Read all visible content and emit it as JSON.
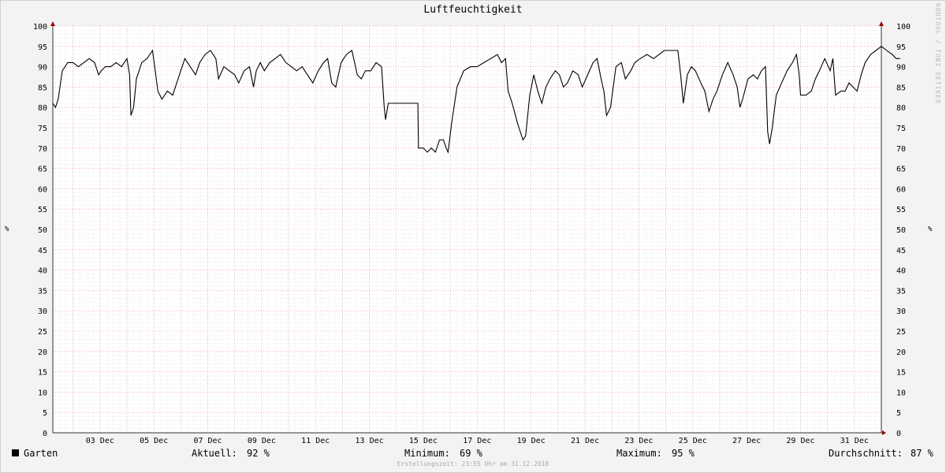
{
  "chart_data": {
    "type": "line",
    "title": "Luftfeuchtigkeit",
    "ylabel": "%",
    "ylim": [
      0,
      100
    ],
    "y_ticks": [
      0,
      5,
      10,
      15,
      20,
      25,
      30,
      35,
      40,
      45,
      50,
      55,
      60,
      65,
      70,
      75,
      80,
      85,
      90,
      95,
      100
    ],
    "x_tick_labels": [
      "03 Dec",
      "05 Dec",
      "07 Dec",
      "09 Dec",
      "11 Dec",
      "13 Dec",
      "15 Dec",
      "17 Dec",
      "19 Dec",
      "21 Dec",
      "23 Dec",
      "25 Dec",
      "27 Dec",
      "29 Dec",
      "31 Dec"
    ],
    "x_tick_days": [
      3,
      5,
      7,
      9,
      11,
      13,
      15,
      17,
      19,
      21,
      23,
      25,
      27,
      29,
      31
    ],
    "xlim_days": [
      1.25,
      32.0
    ],
    "grid": true,
    "series": [
      {
        "name": "Garten",
        "color": "#000000",
        "points": [
          [
            1.25,
            81
          ],
          [
            1.35,
            80
          ],
          [
            1.45,
            82
          ],
          [
            1.6,
            89
          ],
          [
            1.8,
            91
          ],
          [
            2.0,
            91
          ],
          [
            2.2,
            90
          ],
          [
            2.4,
            91
          ],
          [
            2.6,
            92
          ],
          [
            2.8,
            91
          ],
          [
            2.95,
            88
          ],
          [
            3.05,
            89
          ],
          [
            3.2,
            90
          ],
          [
            3.4,
            90
          ],
          [
            3.6,
            91
          ],
          [
            3.8,
            90
          ],
          [
            4.0,
            92
          ],
          [
            4.1,
            88
          ],
          [
            4.15,
            78
          ],
          [
            4.25,
            80
          ],
          [
            4.35,
            87
          ],
          [
            4.55,
            91
          ],
          [
            4.75,
            92
          ],
          [
            4.95,
            94
          ],
          [
            5.05,
            89
          ],
          [
            5.15,
            84
          ],
          [
            5.3,
            82
          ],
          [
            5.5,
            84
          ],
          [
            5.7,
            83
          ],
          [
            5.85,
            86
          ],
          [
            6.0,
            89
          ],
          [
            6.15,
            92
          ],
          [
            6.35,
            90
          ],
          [
            6.55,
            88
          ],
          [
            6.7,
            91
          ],
          [
            6.9,
            93
          ],
          [
            7.1,
            94
          ],
          [
            7.3,
            92
          ],
          [
            7.4,
            87
          ],
          [
            7.6,
            90
          ],
          [
            7.8,
            89
          ],
          [
            8.0,
            88
          ],
          [
            8.15,
            86
          ],
          [
            8.35,
            89
          ],
          [
            8.55,
            90
          ],
          [
            8.7,
            85
          ],
          [
            8.8,
            89
          ],
          [
            8.95,
            91
          ],
          [
            9.1,
            89
          ],
          [
            9.3,
            91
          ],
          [
            9.5,
            92
          ],
          [
            9.7,
            93
          ],
          [
            9.9,
            91
          ],
          [
            10.1,
            90
          ],
          [
            10.3,
            89
          ],
          [
            10.5,
            90
          ],
          [
            10.7,
            88
          ],
          [
            10.9,
            86
          ],
          [
            11.1,
            89
          ],
          [
            11.3,
            91
          ],
          [
            11.45,
            92
          ],
          [
            11.6,
            86
          ],
          [
            11.75,
            85
          ],
          [
            11.95,
            91
          ],
          [
            12.15,
            93
          ],
          [
            12.35,
            94
          ],
          [
            12.55,
            88
          ],
          [
            12.7,
            87
          ],
          [
            12.85,
            89
          ],
          [
            13.05,
            89
          ],
          [
            13.25,
            91
          ],
          [
            13.45,
            90
          ],
          [
            13.55,
            80
          ],
          [
            13.6,
            77
          ],
          [
            13.7,
            81
          ],
          [
            14.8,
            81
          ],
          [
            14.82,
            70
          ],
          [
            15.0,
            70
          ],
          [
            15.15,
            69
          ],
          [
            15.3,
            70
          ],
          [
            15.45,
            69
          ],
          [
            15.6,
            72
          ],
          [
            15.75,
            72
          ],
          [
            15.85,
            70
          ],
          [
            15.92,
            69
          ],
          [
            16.05,
            76
          ],
          [
            16.25,
            85
          ],
          [
            16.5,
            89
          ],
          [
            16.75,
            90
          ],
          [
            17.0,
            90
          ],
          [
            17.25,
            91
          ],
          [
            17.5,
            92
          ],
          [
            17.75,
            93
          ],
          [
            17.9,
            91
          ],
          [
            18.05,
            92
          ],
          [
            18.15,
            84
          ],
          [
            18.3,
            81
          ],
          [
            18.5,
            76
          ],
          [
            18.7,
            72
          ],
          [
            18.8,
            73
          ],
          [
            18.95,
            83
          ],
          [
            19.1,
            88
          ],
          [
            19.25,
            84
          ],
          [
            19.4,
            81
          ],
          [
            19.55,
            85
          ],
          [
            19.7,
            87
          ],
          [
            19.9,
            89
          ],
          [
            20.05,
            88
          ],
          [
            20.2,
            85
          ],
          [
            20.35,
            86
          ],
          [
            20.55,
            89
          ],
          [
            20.75,
            88
          ],
          [
            20.9,
            85
          ],
          [
            21.1,
            88
          ],
          [
            21.3,
            91
          ],
          [
            21.45,
            92
          ],
          [
            21.6,
            87
          ],
          [
            21.7,
            84
          ],
          [
            21.8,
            78
          ],
          [
            21.95,
            80
          ],
          [
            22.15,
            90
          ],
          [
            22.35,
            91
          ],
          [
            22.5,
            87
          ],
          [
            22.7,
            89
          ],
          [
            22.85,
            91
          ],
          [
            23.05,
            92
          ],
          [
            23.3,
            93
          ],
          [
            23.55,
            92
          ],
          [
            23.75,
            93
          ],
          [
            23.95,
            94
          ],
          [
            24.2,
            94
          ],
          [
            24.45,
            94
          ],
          [
            24.55,
            88
          ],
          [
            24.65,
            81
          ],
          [
            24.8,
            88
          ],
          [
            24.95,
            90
          ],
          [
            25.1,
            89
          ],
          [
            25.3,
            86
          ],
          [
            25.45,
            84
          ],
          [
            25.6,
            79
          ],
          [
            25.75,
            82
          ],
          [
            25.9,
            84
          ],
          [
            26.1,
            88
          ],
          [
            26.3,
            91
          ],
          [
            26.5,
            88
          ],
          [
            26.65,
            85
          ],
          [
            26.75,
            80
          ],
          [
            26.85,
            82
          ],
          [
            27.05,
            87
          ],
          [
            27.25,
            88
          ],
          [
            27.4,
            87
          ],
          [
            27.55,
            89
          ],
          [
            27.7,
            90
          ],
          [
            27.78,
            74
          ],
          [
            27.85,
            71
          ],
          [
            27.95,
            75
          ],
          [
            28.1,
            83
          ],
          [
            28.3,
            86
          ],
          [
            28.5,
            89
          ],
          [
            28.7,
            91
          ],
          [
            28.85,
            93
          ],
          [
            28.95,
            88
          ],
          [
            29.0,
            83
          ],
          [
            29.2,
            83
          ],
          [
            29.4,
            84
          ],
          [
            29.55,
            87
          ],
          [
            29.7,
            89
          ],
          [
            29.9,
            92
          ],
          [
            30.1,
            89
          ],
          [
            30.2,
            92
          ],
          [
            30.3,
            83
          ],
          [
            30.5,
            84
          ],
          [
            30.65,
            84
          ],
          [
            30.8,
            86
          ],
          [
            30.95,
            85
          ],
          [
            31.1,
            84
          ],
          [
            31.25,
            88
          ],
          [
            31.4,
            91
          ],
          [
            31.6,
            93
          ],
          [
            31.8,
            94
          ],
          [
            32.0,
            95
          ],
          [
            32.2,
            94
          ],
          [
            32.4,
            93
          ],
          [
            32.55,
            92
          ],
          [
            32.7,
            92
          ]
        ]
      }
    ]
  },
  "legend": {
    "series_label": "Garten",
    "aktuell_label": "Aktuell:",
    "aktuell_value": "92 %",
    "minimum_label": "Minimum:",
    "minimum_value": "69 %",
    "maximum_label": "Maximum:",
    "maximum_value": "95 %",
    "durchschnitt_label": "Durchschnitt:",
    "durchschnitt_value": "87 %"
  },
  "footer": "Erstellungszeit: 23:55 Uhr am 31.12.2018",
  "watermark": "RRDTOOL / TOBI OETIKER",
  "unit_left": "%",
  "unit_right": "%"
}
